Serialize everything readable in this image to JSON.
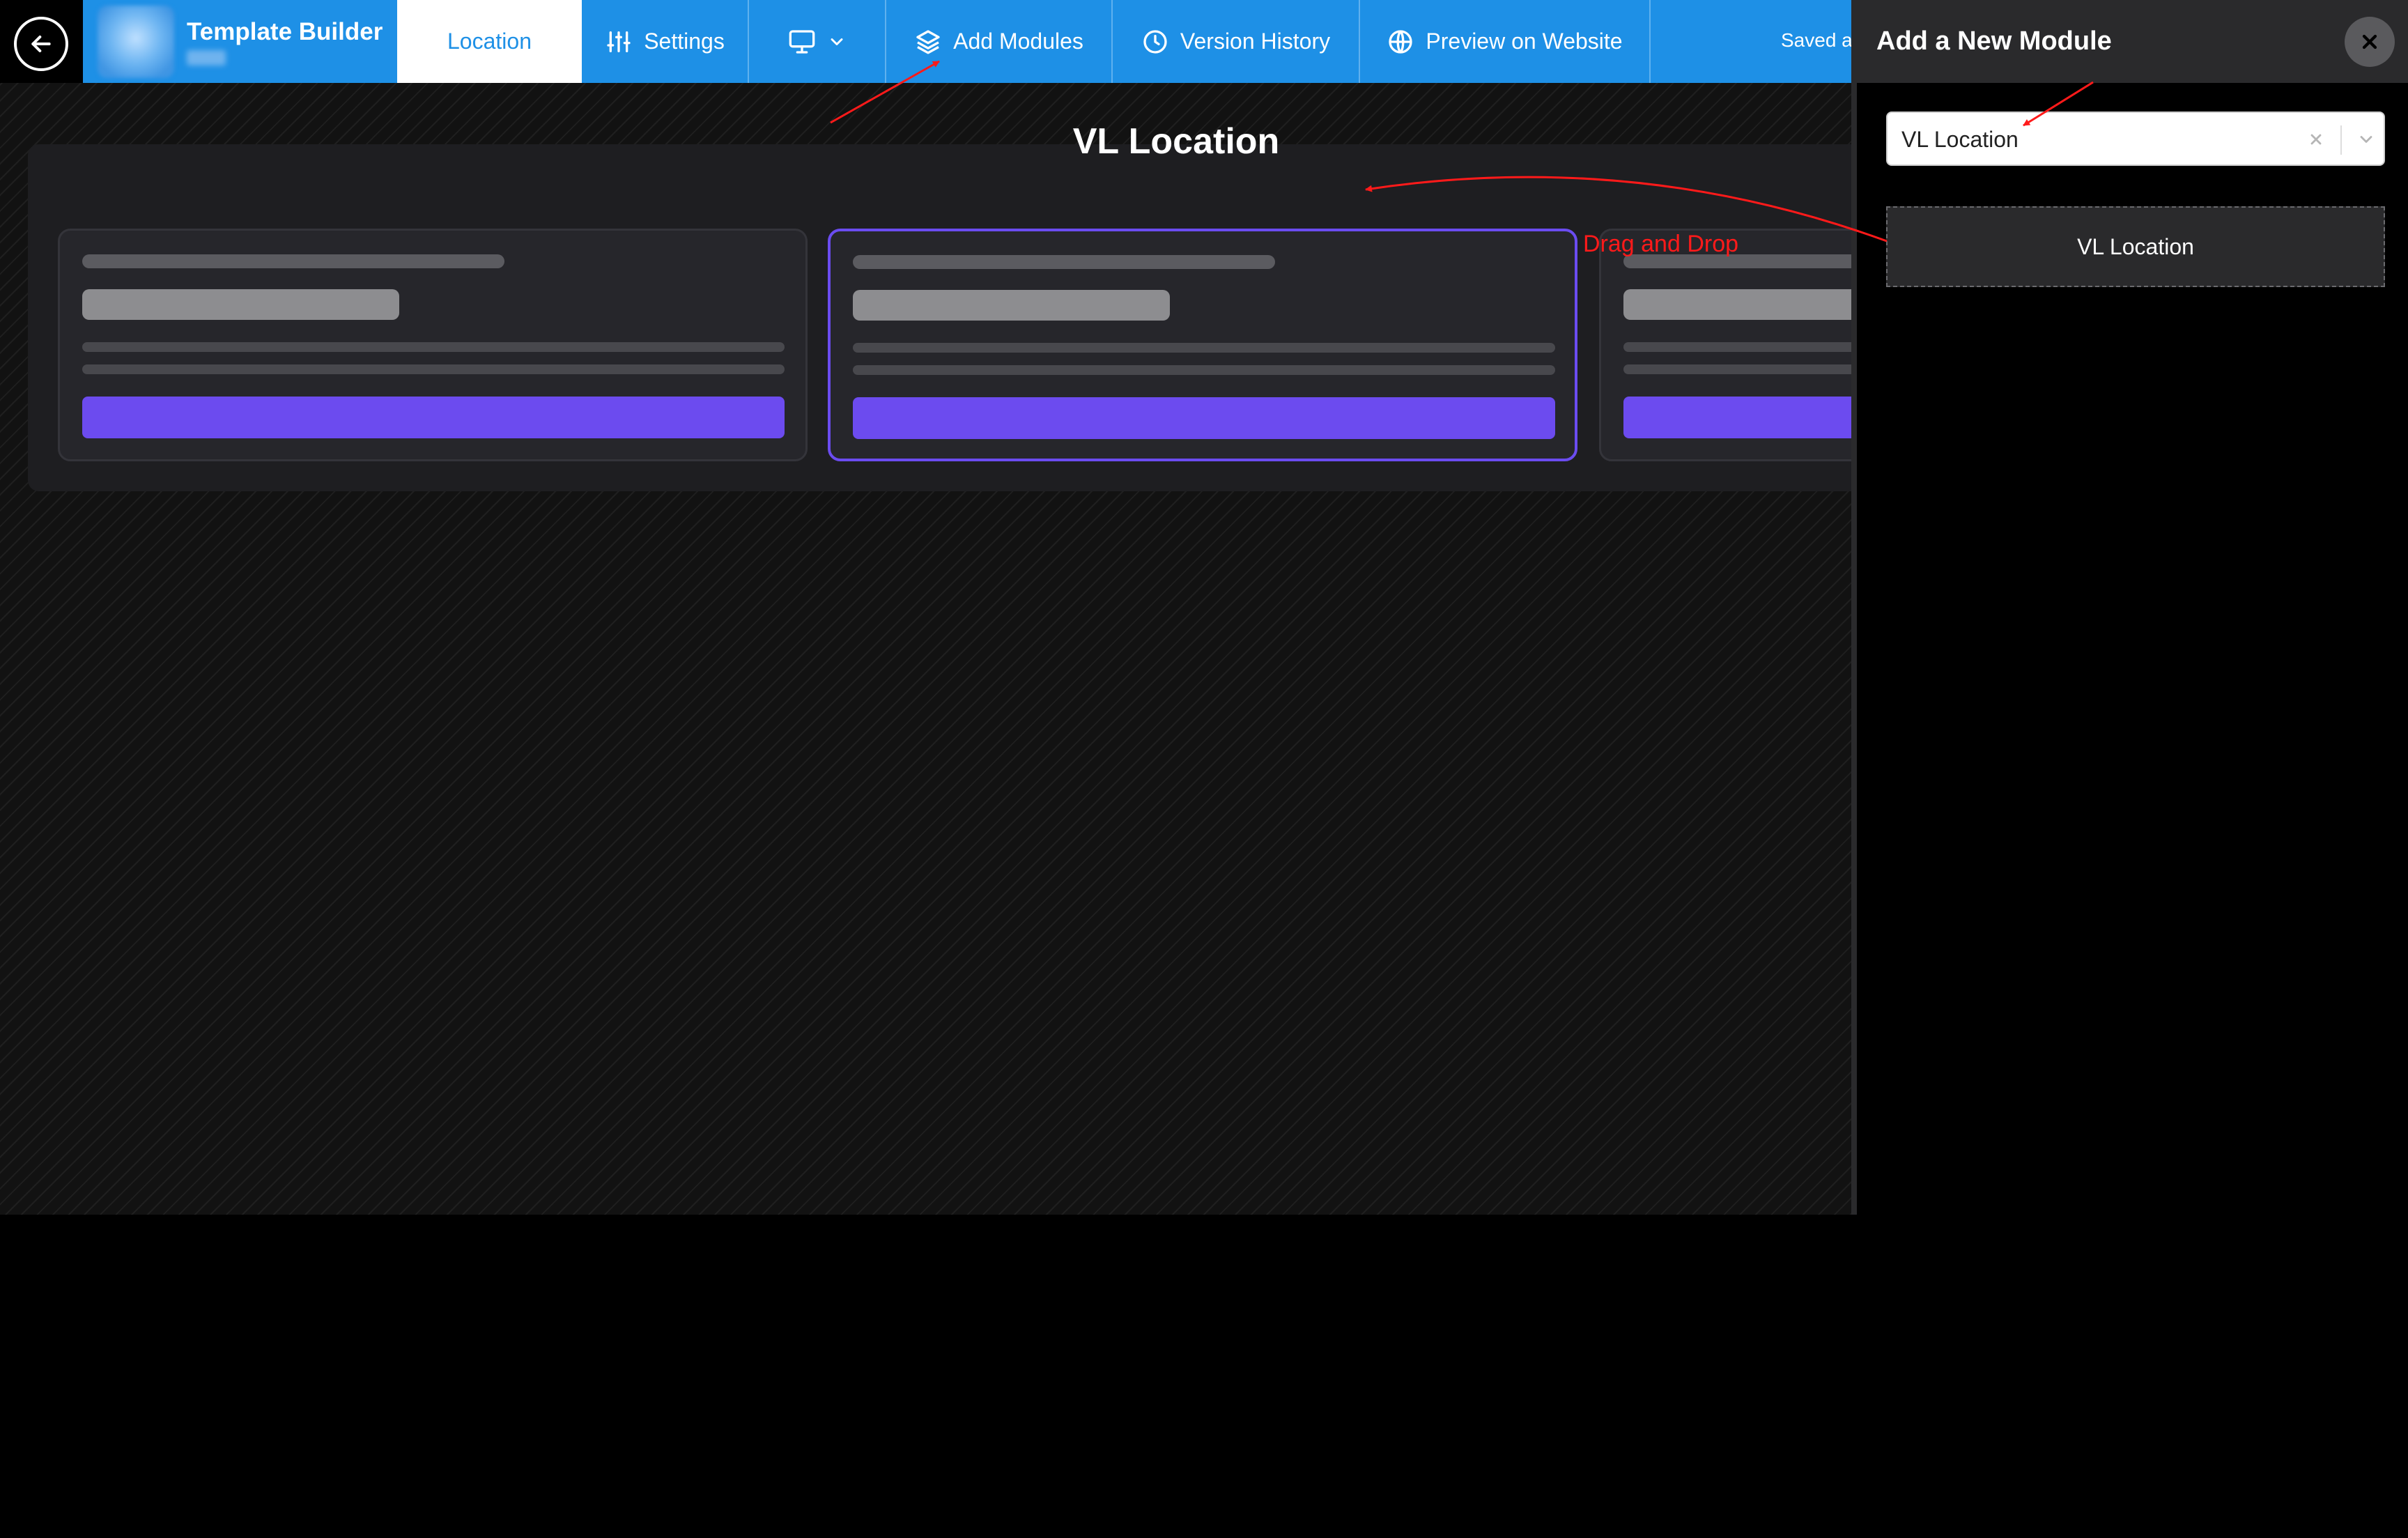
{
  "header": {
    "brand_title": "Template Builder",
    "tabs": {
      "location": "Location",
      "settings": "Settings",
      "add_modules": "Add Modules",
      "version_history": "Version History",
      "preview": "Preview on Website"
    },
    "saved_text": "Saved a",
    "accent_color": "#1e90e6"
  },
  "canvas": {
    "module_title": "VL Location",
    "annotation": "Drag and Drop",
    "button_color": "#6c4bef"
  },
  "panel": {
    "title": "Add a New Module",
    "select_value": "VL Location",
    "module_item": "VL Location"
  }
}
